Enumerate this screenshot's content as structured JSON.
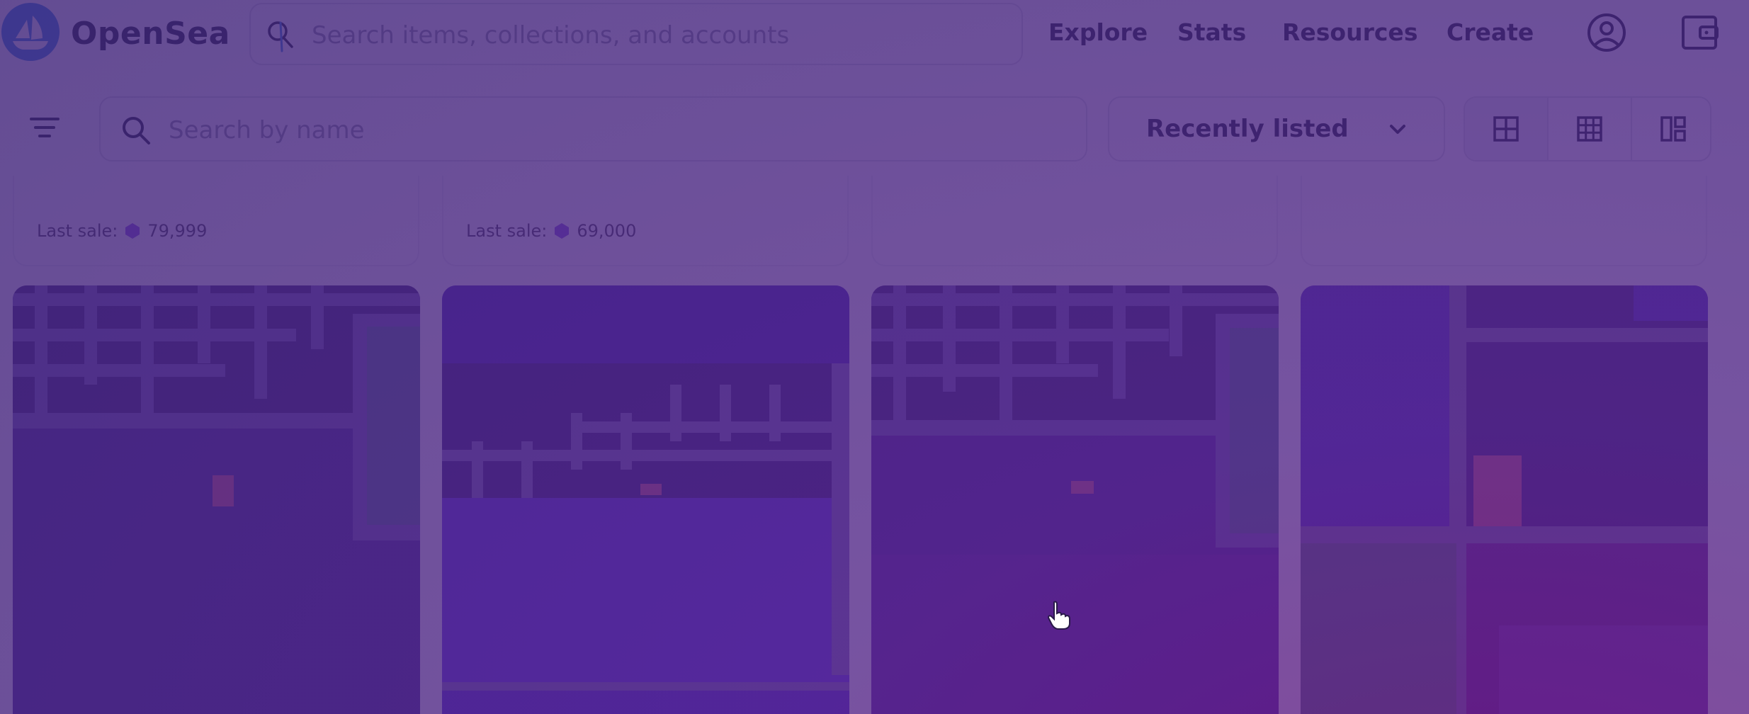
{
  "app": {
    "brand": "OpenSea"
  },
  "header": {
    "search_placeholder": "Search items, collections, and accounts",
    "nav": [
      "Explore",
      "Stats",
      "Resources",
      "Create"
    ],
    "icons": {
      "account": "account-circle-icon",
      "wallet": "wallet-icon",
      "logo": "opensea-ship-icon"
    }
  },
  "filters": {
    "search_placeholder": "Search by name",
    "sort_selected": "Recently listed",
    "views": [
      "large-grid",
      "small-grid",
      "mixed-grid"
    ]
  },
  "previous_row": [
    {
      "last_sale_label": "Last sale:",
      "last_sale_value": "79,999"
    },
    {
      "last_sale_label": "Last sale:",
      "last_sale_value": "69,000"
    },
    {
      "last_sale_label": "",
      "last_sale_value": ""
    },
    {
      "last_sale_label": "",
      "last_sale_value": ""
    }
  ],
  "colors": {
    "accent": "#2081e2",
    "text": "#04111d",
    "muted": "#8a939b",
    "overlay": "#3a266c"
  }
}
